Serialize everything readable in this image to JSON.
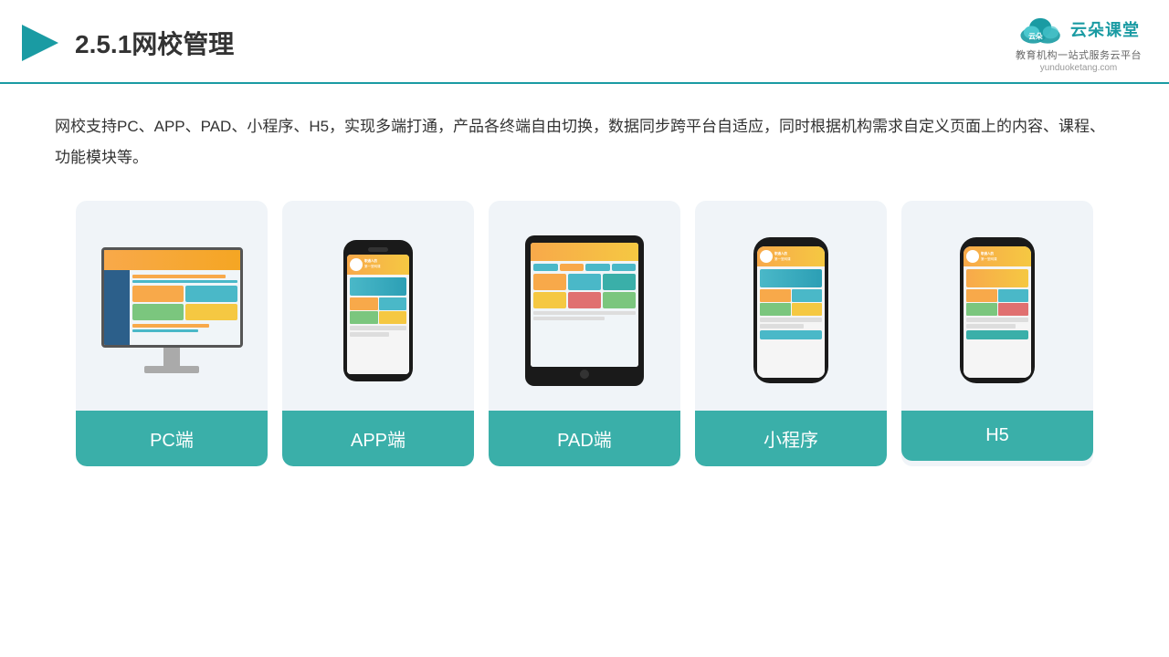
{
  "header": {
    "title": "2.5.1网校管理",
    "logo_main": "云朵课堂",
    "logo_sub": "教育机构一站\n式服务云平台",
    "logo_url": "yunduoketang.com"
  },
  "description": "网校支持PC、APP、PAD、小程序、H5，实现多端打通，产品各终端自由切换，数据同步跨平台自适应，同时根据机构需求自定义页面上的内容、课程、功能模块等。",
  "cards": [
    {
      "id": "pc",
      "label": "PC端"
    },
    {
      "id": "app",
      "label": "APP端"
    },
    {
      "id": "pad",
      "label": "PAD端"
    },
    {
      "id": "miniprogram",
      "label": "小程序"
    },
    {
      "id": "h5",
      "label": "H5"
    }
  ]
}
